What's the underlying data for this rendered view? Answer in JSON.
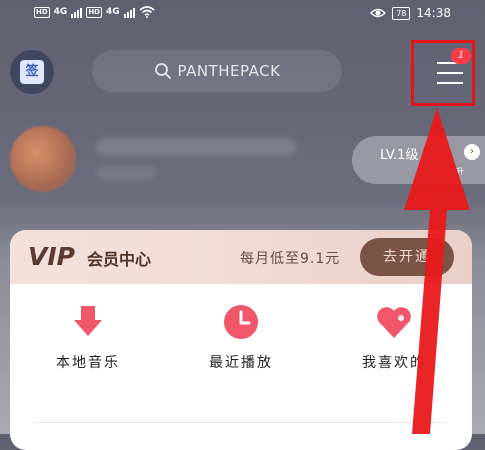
{
  "status_bar": {
    "left": {
      "hd1": "HD",
      "net1": "4G",
      "hd2": "HD",
      "net2": "4G"
    },
    "right": {
      "battery": "78",
      "time": "14:38"
    },
    "icons": [
      "eye-icon",
      "wifi-icon",
      "signal-icon"
    ]
  },
  "header": {
    "calendar_label": "签",
    "search": {
      "text": "PANTHEPACK"
    },
    "menu": {
      "badge": "1"
    }
  },
  "profile": {
    "level_label": "LV.1级",
    "level_sub": "升"
  },
  "vip": {
    "logo": "VIP",
    "title": "会员中心",
    "price_text": "每月低至9.1元",
    "button_label": "去开通"
  },
  "quick_actions": [
    {
      "label": "本地音乐",
      "icon": "download-arrow-icon"
    },
    {
      "label": "最近播放",
      "icon": "clock-icon"
    },
    {
      "label": "我喜欢的",
      "icon": "heart-icon"
    }
  ],
  "colors": {
    "accent_red": "#e0161b",
    "icon_pink": "#f0576b",
    "vip_brown": "#7a5445"
  }
}
